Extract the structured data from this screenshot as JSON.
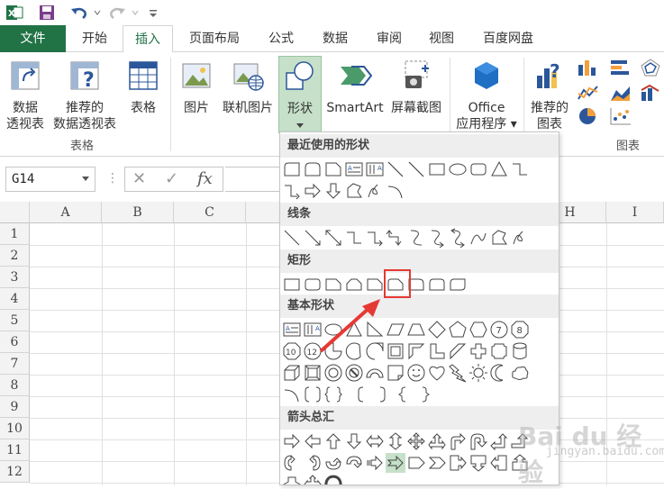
{
  "quick_access": {
    "app_icon": "excel-icon",
    "save_icon": "save-icon",
    "undo_icon": "undo-icon",
    "redo_icon": "redo-icon",
    "customize_icon": "customize-arrow-icon"
  },
  "tabs": [
    {
      "label": "文件"
    },
    {
      "label": "开始"
    },
    {
      "label": "插入"
    },
    {
      "label": "页面布局"
    },
    {
      "label": "公式"
    },
    {
      "label": "数据"
    },
    {
      "label": "审阅"
    },
    {
      "label": "视图"
    },
    {
      "label": "百度网盘"
    }
  ],
  "ribbon": {
    "pivot_table": {
      "line1": "数据",
      "line2": "透视表"
    },
    "recommended_pivot": {
      "line1": "推荐的",
      "line2": "数据透视表"
    },
    "table": {
      "label": "表格"
    },
    "group_tables": "表格",
    "picture": {
      "label": "图片"
    },
    "online_picture": {
      "label": "联机图片"
    },
    "shapes": {
      "label": "形状"
    },
    "smartart": {
      "label": "SmartArt"
    },
    "screenshot": {
      "label": "屏幕截图"
    },
    "office_apps": {
      "line1": "Office",
      "line2": "应用程序"
    },
    "recommended_charts": {
      "line1": "推荐的",
      "line2": "图表"
    },
    "group_charts": "图表"
  },
  "formula_bar": {
    "name_box": "G14",
    "cancel": "✕",
    "enter": "✓",
    "fx": "fx"
  },
  "columns": [
    "A",
    "B",
    "C",
    "I"
  ],
  "extra_column": "H",
  "rows": [
    "1",
    "2",
    "3",
    "4",
    "5",
    "6",
    "7",
    "8",
    "9",
    "10",
    "11",
    "12"
  ],
  "shapes_menu": {
    "recent": "最近使用的形状",
    "lines": "线条",
    "rectangles": "矩形",
    "basic": "基本形状",
    "arrows": "箭头总汇"
  },
  "watermark": {
    "main": "Bai du 经验",
    "sub": "jingyan.baidu.com"
  },
  "colors": {
    "accent": "#217346",
    "highlight": "#e53935"
  }
}
